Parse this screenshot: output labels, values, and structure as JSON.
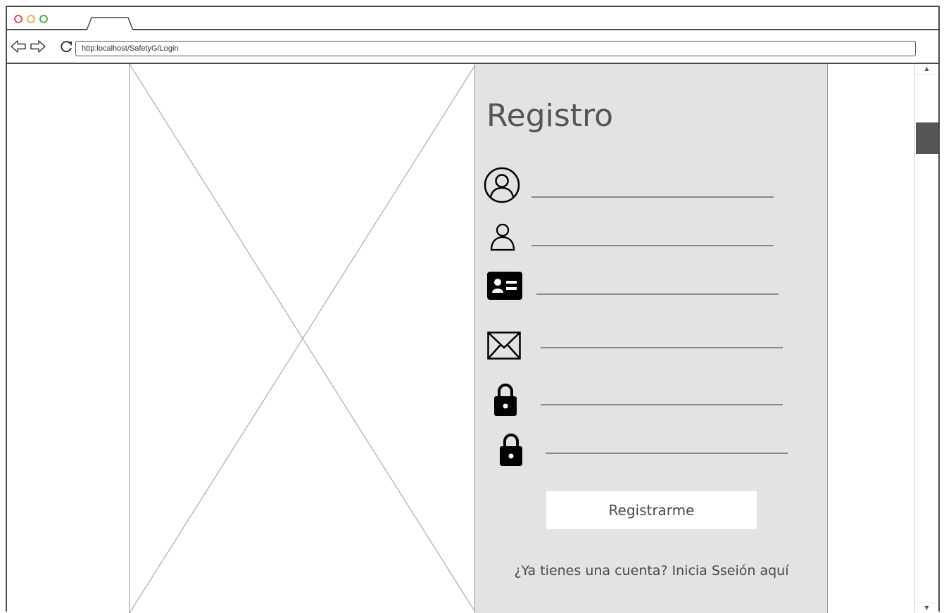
{
  "browser": {
    "url": "http:localhost/SafetyG/Login",
    "back_icon": "arrow-left-icon",
    "forward_icon": "arrow-right-icon",
    "reload_icon": "reload-icon"
  },
  "form": {
    "title": "Registro",
    "fields": [
      {
        "icon": "user-circle-icon",
        "value": ""
      },
      {
        "icon": "user-icon",
        "value": ""
      },
      {
        "icon": "id-card-icon",
        "value": ""
      },
      {
        "icon": "envelope-icon",
        "value": ""
      },
      {
        "icon": "lock-icon",
        "value": ""
      },
      {
        "icon": "lock-icon",
        "value": ""
      }
    ],
    "submit_label": "Registrarme",
    "login_prompt": "¿Ya tienes una cuenta? Inicia Sseión aquí"
  },
  "colors": {
    "panel_bg": "#e3e3e3",
    "traffic_red": "#d9534f",
    "traffic_yellow": "#f0ad4e",
    "traffic_green": "#46b046"
  }
}
